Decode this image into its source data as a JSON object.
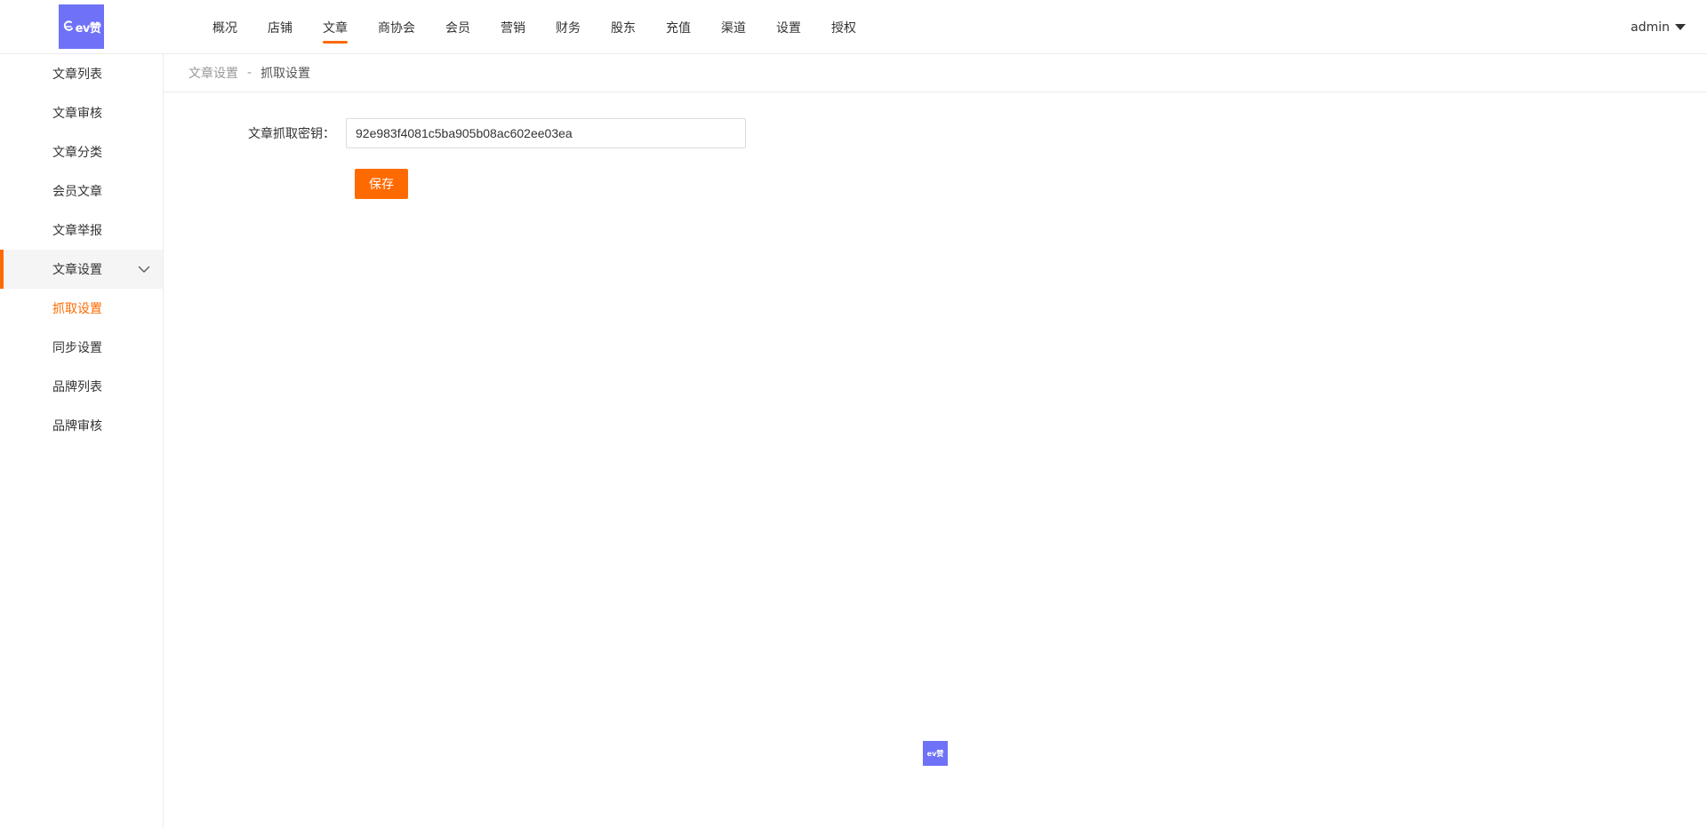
{
  "header": {
    "logo_text": "ev赞",
    "nav": [
      {
        "label": "概况",
        "active": false
      },
      {
        "label": "店铺",
        "active": false
      },
      {
        "label": "文章",
        "active": true
      },
      {
        "label": "商协会",
        "active": false
      },
      {
        "label": "会员",
        "active": false
      },
      {
        "label": "营销",
        "active": false
      },
      {
        "label": "财务",
        "active": false
      },
      {
        "label": "股东",
        "active": false
      },
      {
        "label": "充值",
        "active": false
      },
      {
        "label": "渠道",
        "active": false
      },
      {
        "label": "设置",
        "active": false
      },
      {
        "label": "授权",
        "active": false
      }
    ],
    "user": "admin"
  },
  "sidebar": {
    "items": [
      {
        "label": "文章列表"
      },
      {
        "label": "文章审核"
      },
      {
        "label": "文章分类"
      },
      {
        "label": "会员文章"
      },
      {
        "label": "文章举报"
      },
      {
        "label": "文章设置",
        "expanded": true
      },
      {
        "label": "抓取设置",
        "selected": true
      },
      {
        "label": "同步设置"
      },
      {
        "label": "品牌列表"
      },
      {
        "label": "品牌审核"
      }
    ]
  },
  "breadcrumb": {
    "parent": "文章设置",
    "separator": "-",
    "current": "抓取设置"
  },
  "form": {
    "key_label": "文章抓取密钥：",
    "key_value": "92e983f4081c5ba905b08ac602ee03ea",
    "save_label": "保存"
  },
  "floating_badge": {
    "text": "ev赞"
  },
  "colors": {
    "accent": "#ff6a00",
    "logo_bg": "#6f72f6"
  }
}
